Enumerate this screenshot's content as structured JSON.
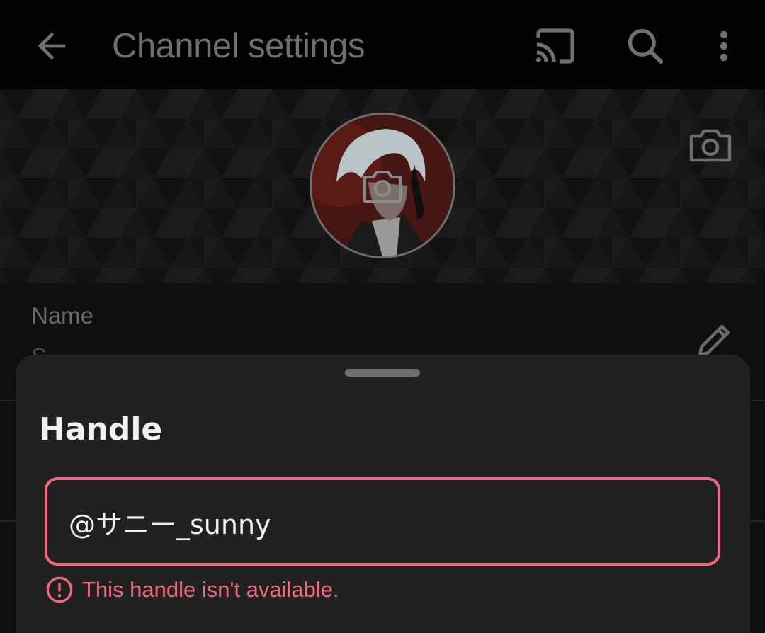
{
  "app_bar": {
    "title": "Channel settings",
    "icons": [
      "back-icon",
      "cast-icon",
      "search-icon",
      "more-vert-icon"
    ]
  },
  "banner": {
    "icons": [
      "camera-icon"
    ]
  },
  "settings": {
    "name_label": "Name",
    "name_value": "S"
  },
  "sheet": {
    "title": "Handle",
    "handle_value": "@サニー_sunny",
    "error_text": "This handle isn't available.",
    "error_color": "#f0697f"
  },
  "colors": {
    "background": "#0e0e0e",
    "sheet": "#212121",
    "error": "#f0697f",
    "text_primary": "#f1f1f1"
  }
}
